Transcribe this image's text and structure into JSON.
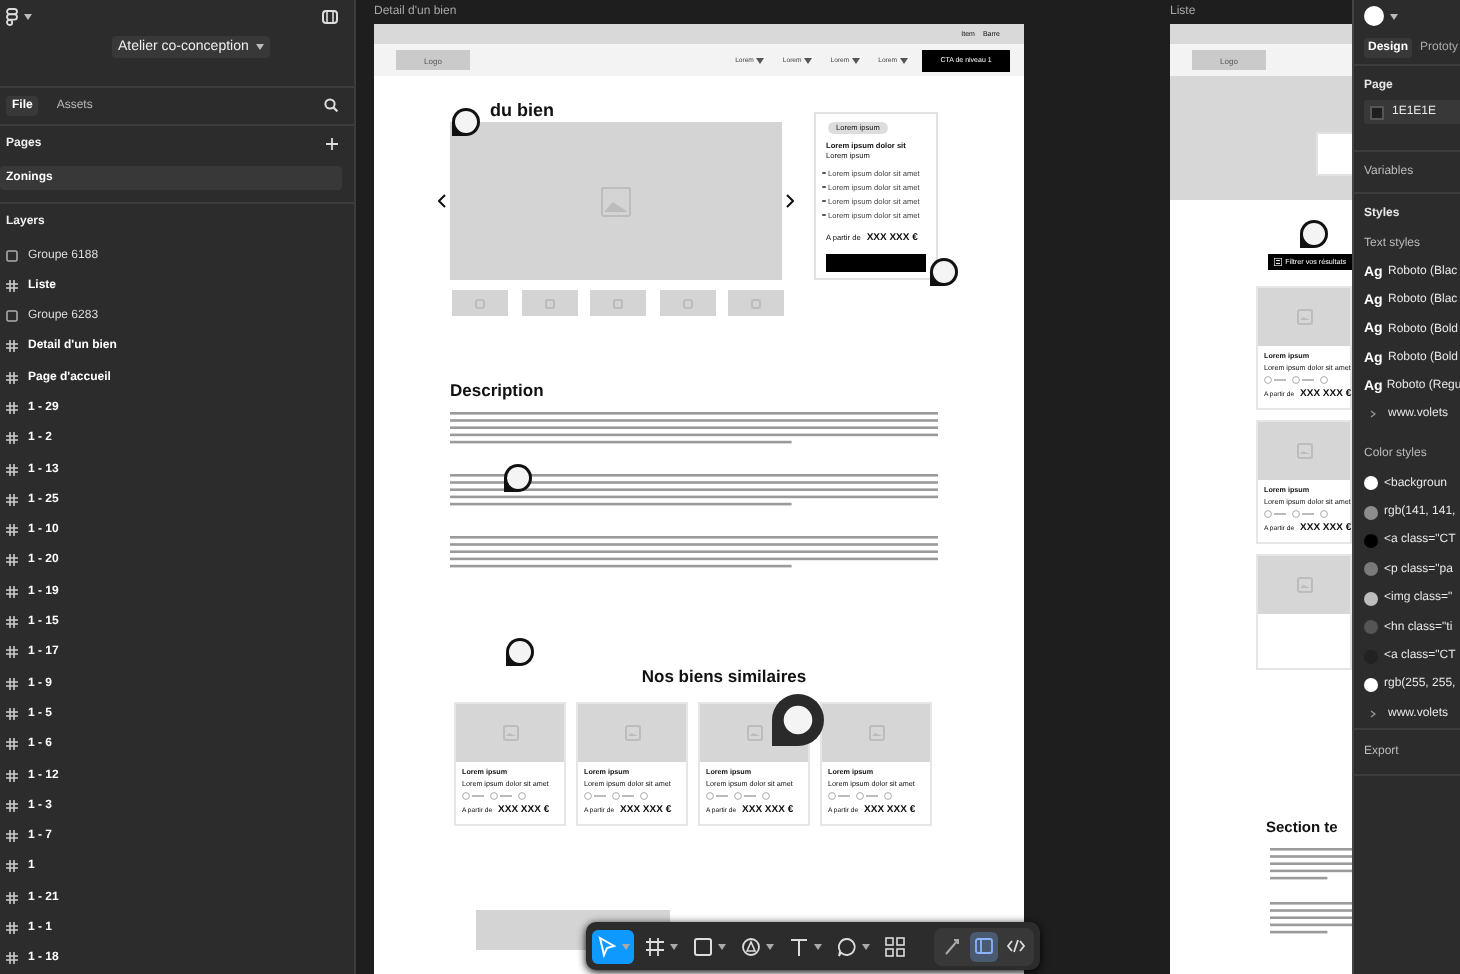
{
  "project": {
    "name": "Atelier co-conception"
  },
  "left_panel": {
    "tabs": [
      {
        "label": "File",
        "selected": true
      },
      {
        "label": "Assets",
        "selected": false
      }
    ],
    "pages_heading": "Pages",
    "pages": [
      {
        "label": "Zonings",
        "selected": true
      }
    ],
    "layers_heading": "Layers",
    "layers": [
      {
        "kind": "group",
        "label": "Groupe 6188"
      },
      {
        "kind": "frame",
        "label": "Liste"
      },
      {
        "kind": "group",
        "label": "Groupe 6283"
      },
      {
        "kind": "frame",
        "label": "Detail d'un bien"
      },
      {
        "kind": "frame",
        "label": "Page d'accueil"
      },
      {
        "kind": "frame",
        "label": "1 - 29"
      },
      {
        "kind": "frame",
        "label": "1 - 2"
      },
      {
        "kind": "frame",
        "label": "1 - 13"
      },
      {
        "kind": "frame",
        "label": "1 - 25"
      },
      {
        "kind": "frame",
        "label": "1 - 10"
      },
      {
        "kind": "frame",
        "label": "1 - 20"
      },
      {
        "kind": "frame",
        "label": "1 - 19"
      },
      {
        "kind": "frame",
        "label": "1 - 15"
      },
      {
        "kind": "frame",
        "label": "1 - 17"
      },
      {
        "kind": "frame",
        "label": "1 - 9"
      },
      {
        "kind": "frame",
        "label": "1 - 5"
      },
      {
        "kind": "frame",
        "label": "1 - 6"
      },
      {
        "kind": "frame",
        "label": "1 - 12"
      },
      {
        "kind": "frame",
        "label": "1 - 3"
      },
      {
        "kind": "frame",
        "label": "1 - 7"
      },
      {
        "kind": "frame",
        "label": "1"
      },
      {
        "kind": "frame",
        "label": "1 - 21"
      },
      {
        "kind": "frame",
        "label": "1 - 1"
      },
      {
        "kind": "frame",
        "label": "1 - 18"
      }
    ]
  },
  "detail_frame": {
    "title": "Detail d'un bien",
    "top_bar": [
      "Item",
      "Barre"
    ],
    "logo": "Logo",
    "nav_links": [
      "Lorem",
      "Lorem",
      "Lorem",
      "Lorem"
    ],
    "cta": "CTA de niveau 1",
    "heading": "du bien",
    "offer_card": {
      "badge": "Lorem ipsum",
      "title": "Lorem ipsum dolor sit",
      "subtitle": "Lorem ipsum",
      "bullets": [
        "Lorem ipsum dolor sit amet",
        "Lorem ipsum dolor sit amet",
        "Lorem ipsum dolor sit amet",
        "Lorem ipsum dolor sit amet"
      ],
      "price_prefix": "A partir de",
      "price": "XXX XXX €"
    },
    "description_heading": "Description",
    "similar_heading": "Nos biens similaires",
    "cards": [
      {
        "title": "Lorem ipsum",
        "subtitle": "Lorem ipsum dolor sit amet",
        "price_prefix": "A partir de",
        "price": "XXX XXX €"
      },
      {
        "title": "Lorem ipsum",
        "subtitle": "Lorem ipsum dolor sit amet",
        "price_prefix": "A partir de",
        "price": "XXX XXX €"
      },
      {
        "title": "Lorem ipsum",
        "subtitle": "Lorem ipsum dolor sit amet",
        "price_prefix": "A partir de",
        "price": "XXX XXX €"
      },
      {
        "title": "Lorem ipsum",
        "subtitle": "Lorem ipsum dolor sit amet",
        "price_prefix": "A partir de",
        "price": "XXX XXX €"
      }
    ]
  },
  "list_frame": {
    "title": "Liste",
    "logo": "Logo",
    "filter_button": "Filtrer vos résultats",
    "section_heading": "Section te",
    "cards": [
      {
        "title": "Lorem ipsum",
        "subtitle": "Lorem ipsum dolor sit amet",
        "price_prefix": "A partir de",
        "price": "XXX XXX €"
      },
      {
        "title": "Lorem ipsum",
        "subtitle": "Lorem ipsum dolor sit amet",
        "price_prefix": "A partir de",
        "price": "XXX XXX €"
      }
    ]
  },
  "toolbar": {
    "tools": [
      {
        "kind": "move",
        "selected": true
      },
      {
        "kind": "frame",
        "selected": false
      },
      {
        "kind": "rectangle",
        "selected": false
      },
      {
        "kind": "pen",
        "selected": false
      },
      {
        "kind": "text",
        "selected": false
      },
      {
        "kind": "comment",
        "selected": false
      },
      {
        "kind": "components",
        "selected": false
      }
    ],
    "modes": [
      {
        "kind": "draw",
        "selected": false
      },
      {
        "kind": "design",
        "selected": true
      },
      {
        "kind": "dev",
        "selected": false
      }
    ]
  },
  "right_panel": {
    "tabs": [
      {
        "label": "Design",
        "selected": true
      },
      {
        "label": "Prototy",
        "selected": false
      }
    ],
    "page_heading": "Page",
    "page_color": "1E1E1E",
    "variables": "Variables",
    "styles_heading": "Styles",
    "text_styles_heading": "Text styles",
    "text_styles": [
      {
        "sample": "Ag",
        "label": "Roboto (Blac"
      },
      {
        "sample": "Ag",
        "label": "Roboto (Blac"
      },
      {
        "sample": "Ag",
        "label": "Roboto (Bold"
      },
      {
        "sample": "Ag",
        "label": "Roboto (Bold"
      },
      {
        "sample": "Ag",
        "label": "Roboto (Regu"
      }
    ],
    "text_styles_folder": "www.volets",
    "color_styles_heading": "Color styles",
    "color_styles": [
      {
        "color": "#ffffff",
        "label": "<backgroun"
      },
      {
        "color": "#8d8d8d",
        "label": "rgb(141, 141,"
      },
      {
        "color": "#000000",
        "label": "<a class=\"CT"
      },
      {
        "color": "#7a7a7a",
        "label": "<p class=\"pa"
      },
      {
        "color": "#bdbdbd",
        "label": "<img class=\""
      },
      {
        "color": "#555555",
        "label": "<hn class=\"ti"
      },
      {
        "color": "#222222",
        "label": "<a class=\"CT"
      },
      {
        "color": "#ffffff",
        "label": "rgb(255, 255,"
      }
    ],
    "color_styles_folder": "www.volets",
    "export": "Export"
  }
}
